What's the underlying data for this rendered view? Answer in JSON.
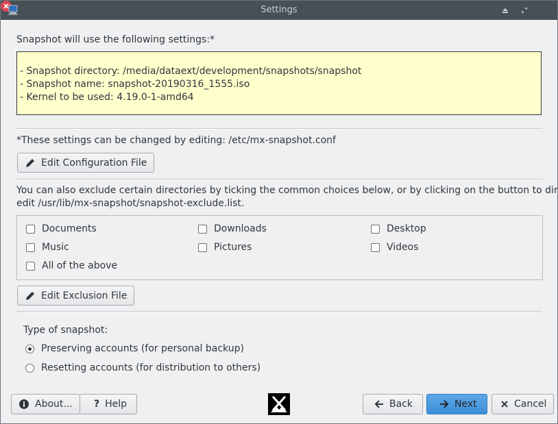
{
  "window": {
    "title": "Settings"
  },
  "intro": {
    "heading": "Snapshot will use the following settings:*",
    "lines": [
      "- Snapshot directory: /media/dataext/development/snapshots/snapshot",
      "- Snapshot name: snapshot-20190316_1555.iso",
      "- Kernel to be used: 4.19.0-1-amd64"
    ]
  },
  "config": {
    "note": "*These settings can be changed by editing: /etc/mx-snapshot.conf",
    "edit_button": "Edit Configuration File"
  },
  "exclude": {
    "description_line1": "You can also exclude certain directories by ticking the common choices below, or by clicking on the button to directly",
    "description_line2": "edit /usr/lib/mx-snapshot/snapshot-exclude.list.",
    "options": {
      "documents": "Documents",
      "downloads": "Downloads",
      "desktop": "Desktop",
      "music": "Music",
      "pictures": "Pictures",
      "videos": "Videos",
      "all": "All of the above"
    },
    "edit_button": "Edit Exclusion File"
  },
  "snapshot_type": {
    "label": "Type of snapshot:",
    "preserving": "Preserving accounts (for personal backup)",
    "resetting": "Resetting accounts (for distribution to others)",
    "selected": "preserving"
  },
  "footer": {
    "about": "About...",
    "help": "Help",
    "back": "Back",
    "next": "Next",
    "cancel": "Cancel"
  },
  "colors": {
    "titlebar": "#475057",
    "info_background": "#ffffcc",
    "primary_button": "#3d8fd8",
    "close_button": "#da4453"
  }
}
